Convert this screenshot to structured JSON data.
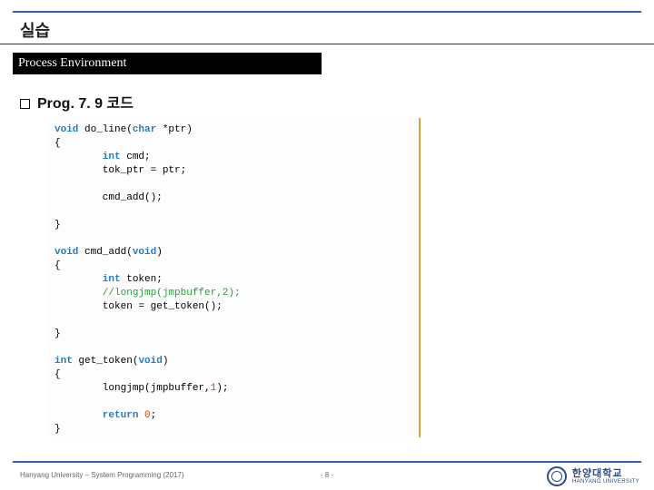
{
  "title": "실습",
  "chapter": "Process Environment",
  "subheading": "Prog.  7. 9 코드",
  "code": {
    "l1a": "void",
    "l1b": " do_line(",
    "l1c": "char",
    "l1d": " *ptr)",
    "l2": "{",
    "l3a": "        int",
    "l3b": " cmd;",
    "l4": "        tok_ptr = ptr;",
    "l5": "",
    "l6": "        cmd_add();",
    "l7": "",
    "l8": "}",
    "l9": "",
    "l10a": "void",
    "l10b": " cmd_add(",
    "l10c": "void",
    "l10d": ")",
    "l11": "{",
    "l12a": "        int",
    "l12b": " token;",
    "l13": "        //longjmp(jmpbuffer,2);",
    "l14": "        token = get_token();",
    "l15": "",
    "l16": "}",
    "l17": "",
    "l18a": "int",
    "l18b": " get_token(",
    "l18c": "void",
    "l18d": ")",
    "l19": "{",
    "l20a": "        longjmp(jmpbuffer,",
    "l20b": "1",
    "l20c": ");",
    "l21": "",
    "l22a": "        return ",
    "l22b": "0",
    "l22c": ";",
    "l23": "}"
  },
  "footer_left": "Hanyang University – System Programming  (2017)",
  "footer_page": "-  8  -",
  "logo_ko": "한양대학교",
  "logo_en": "HANYANG UNIVERSITY"
}
